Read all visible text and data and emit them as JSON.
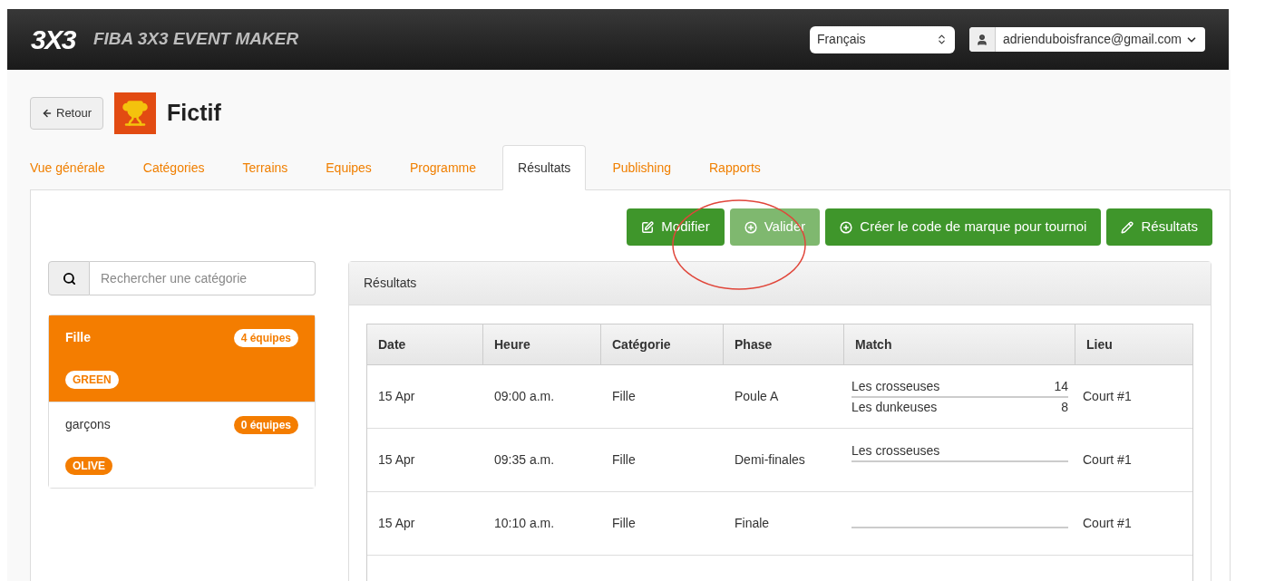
{
  "header": {
    "logo": "3X3",
    "title": "FIBA 3X3 EVENT MAKER",
    "language": "Français",
    "user": "adrienduboisfrance@gmail.com"
  },
  "back_button": "Retour",
  "event_title": "Fictif",
  "tabs": [
    {
      "label": "Vue générale",
      "selected": false
    },
    {
      "label": "Catégories",
      "selected": false
    },
    {
      "label": "Terrains",
      "selected": false
    },
    {
      "label": "Equipes",
      "selected": false
    },
    {
      "label": "Programme",
      "selected": false
    },
    {
      "label": "Résultats",
      "selected": true
    },
    {
      "label": "Publishing",
      "selected": false
    },
    {
      "label": "Rapports",
      "selected": false
    }
  ],
  "actions": [
    {
      "kind": "edit",
      "label": "Modifier",
      "disabled": false
    },
    {
      "kind": "add",
      "label": "Valider",
      "disabled": true
    },
    {
      "kind": "add",
      "label": "Créer le code de marque pour tournoi",
      "disabled": false
    },
    {
      "kind": "pencil",
      "label": "Résultats",
      "disabled": false
    }
  ],
  "search": {
    "placeholder": "Rechercher une catégorie"
  },
  "categories": [
    {
      "name": "Fille",
      "count": "4 équipes",
      "tag": "GREEN",
      "selected": true
    },
    {
      "name": "garçons",
      "count": "0 équipes",
      "tag": "OLIVE",
      "selected": false
    }
  ],
  "results": {
    "title": "Résultats",
    "columns": [
      "Date",
      "Heure",
      "Catégorie",
      "Phase",
      "Match",
      "Lieu"
    ],
    "rows": [
      {
        "date": "15 Apr",
        "time": "09:00 a.m.",
        "category": "Fille",
        "phase": "Poule A",
        "match": [
          {
            "team": "Les crosseuses",
            "score": "14"
          },
          {
            "team": "Les dunkeuses",
            "score": "8"
          }
        ],
        "place": "Court #1"
      },
      {
        "date": "15 Apr",
        "time": "09:35 a.m.",
        "category": "Fille",
        "phase": "Demi-finales",
        "match": [
          {
            "team": "Les crosseuses"
          }
        ],
        "place": "Court #1"
      },
      {
        "date": "15 Apr",
        "time": "10:10 a.m.",
        "category": "Fille",
        "phase": "Finale",
        "match": [],
        "place": "Court #1"
      }
    ]
  }
}
